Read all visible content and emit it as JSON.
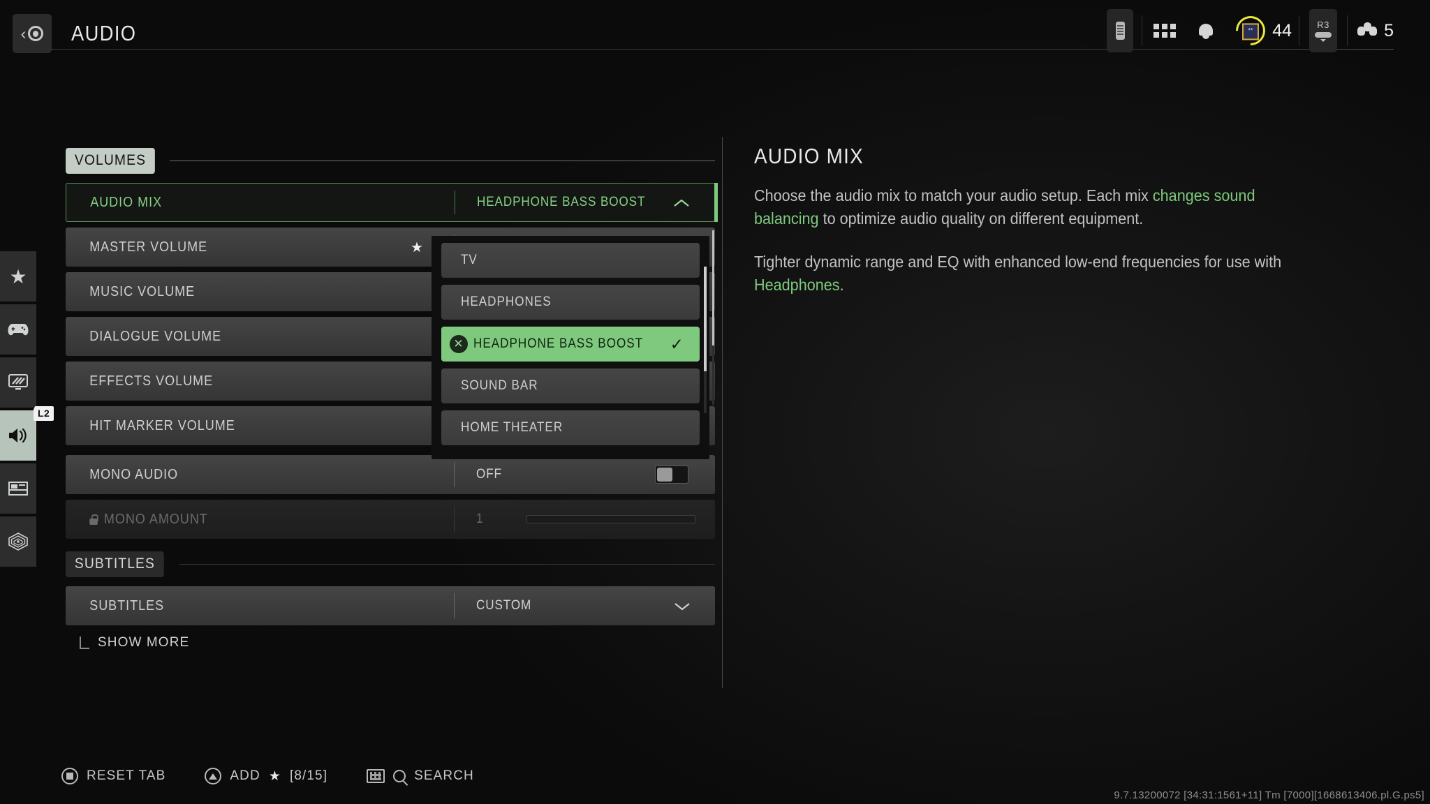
{
  "header": {
    "title": "AUDIO",
    "back_icon": "ps-home-back-icon",
    "battery_icon": "battery-icon",
    "apps_icon": "apps-grid-icon",
    "bell_icon": "notification-bell-icon",
    "rank_stars": "**",
    "rank_level": "44",
    "r3_label": "R3",
    "party_count": "5"
  },
  "rail": {
    "items": [
      {
        "name": "sidebar-item-favorites",
        "icon": "star-icon",
        "active": false
      },
      {
        "name": "sidebar-item-controller",
        "icon": "gamepad-icon",
        "active": false
      },
      {
        "name": "sidebar-item-graphics",
        "icon": "monitor-icon",
        "active": false
      },
      {
        "name": "sidebar-item-audio",
        "icon": "speaker-icon",
        "active": true
      },
      {
        "name": "sidebar-item-interface",
        "icon": "layout-icon",
        "active": false
      },
      {
        "name": "sidebar-item-telemetry",
        "icon": "radar-icon",
        "active": false
      }
    ],
    "shoulder_hint": "L2"
  },
  "sections": {
    "volumes": {
      "label": "VOLUMES",
      "rows": [
        {
          "label": "AUDIO MIX",
          "value": "HEADPHONE BASS BOOST",
          "state": "selected",
          "control": "chevron-up",
          "starred": false
        },
        {
          "label": "MASTER VOLUME",
          "value": "",
          "state": "normal",
          "control": "none",
          "starred": true
        },
        {
          "label": "MUSIC VOLUME",
          "value": "",
          "state": "normal",
          "control": "none",
          "starred": false
        },
        {
          "label": "DIALOGUE VOLUME",
          "value": "",
          "state": "normal",
          "control": "none",
          "starred": false
        },
        {
          "label": "EFFECTS VOLUME",
          "value": "",
          "state": "normal",
          "control": "none",
          "starred": false
        },
        {
          "label": "HIT MARKER VOLUME",
          "value": "",
          "state": "normal",
          "control": "none",
          "starred": false
        },
        {
          "label": "MONO AUDIO",
          "value": "OFF",
          "state": "normal",
          "control": "toggle-off",
          "starred": false
        },
        {
          "label": "MONO AMOUNT",
          "value": "1",
          "state": "disabled",
          "control": "slider",
          "starred": false,
          "locked": true
        }
      ]
    },
    "subtitles": {
      "label": "SUBTITLES",
      "rows": [
        {
          "label": "SUBTITLES",
          "value": "CUSTOM",
          "state": "normal",
          "control": "chevron-down",
          "starred": false
        }
      ],
      "show_more": "SHOW MORE"
    }
  },
  "dropdown": {
    "open_for": "AUDIO MIX",
    "options": [
      {
        "label": "TV",
        "selected": false
      },
      {
        "label": "HEADPHONES",
        "selected": false
      },
      {
        "label": "HEADPHONE BASS BOOST",
        "selected": true
      },
      {
        "label": "SOUND BAR",
        "selected": false
      },
      {
        "label": "HOME THEATER",
        "selected": false
      }
    ],
    "close_glyph": "x-circle-icon",
    "check_glyph": "check-icon"
  },
  "info": {
    "title": "AUDIO MIX",
    "paragraph1_a": "Choose the audio mix to match your audio setup. Each mix ",
    "paragraph1_hl": "changes sound balancing",
    "paragraph1_b": " to optimize audio quality on different equipment.",
    "paragraph2_a": "Tighter dynamic range and EQ with enhanced low-end frequencies for use with ",
    "paragraph2_hl": "Headphones",
    "paragraph2_b": "."
  },
  "footer": {
    "reset_label": "RESET TAB",
    "add_label": "ADD",
    "add_count": "[8/15]",
    "search_label": "SEARCH",
    "version": "9.7.13200072 [34:31:1561+11] Tm [7000][1668613406.pl.G.ps5]"
  },
  "colors": {
    "accent_green": "#7ec97e",
    "text_green": "#86d086",
    "chip": "#c3cdc5",
    "row": "#3c3c3c",
    "bg": "#0a0a0a"
  }
}
